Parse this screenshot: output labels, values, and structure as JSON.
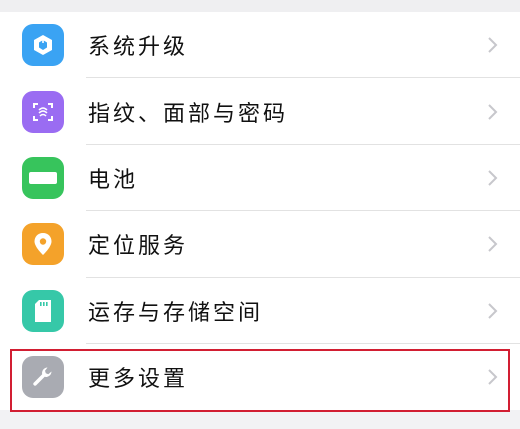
{
  "settings": {
    "items": [
      {
        "label": "系统升级",
        "icon": "system-update-icon",
        "color": "#3aa3f3"
      },
      {
        "label": "指纹、面部与密码",
        "icon": "fingerprint-icon",
        "color": "#9a6cf2"
      },
      {
        "label": "电池",
        "icon": "battery-icon",
        "color": "#37c45c"
      },
      {
        "label": "定位服务",
        "icon": "location-pin-icon",
        "color": "#f4a22a"
      },
      {
        "label": "运存与存储空间",
        "icon": "sd-card-icon",
        "color": "#36c8a8"
      },
      {
        "label": "更多设置",
        "icon": "wrench-icon",
        "color": "#a9abb2"
      }
    ],
    "highlight_color": "#d21e32"
  }
}
